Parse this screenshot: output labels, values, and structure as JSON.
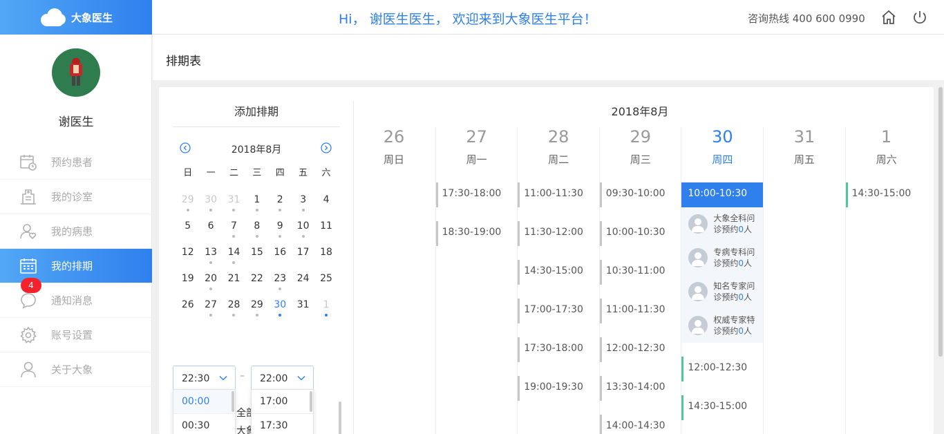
{
  "header": {
    "logo_text": "大象医生",
    "welcome": "Hi， 谢医生医生， 欢迎来到大象医生平台！",
    "hotline": "咨询热线 400 600 0990"
  },
  "sidebar": {
    "doctor_name": "谢医生",
    "items": [
      {
        "label": "预约患者",
        "icon": "calendar-clock-icon"
      },
      {
        "label": "我的诊室",
        "icon": "building-icon"
      },
      {
        "label": "我的病患",
        "icon": "patient-heart-icon"
      },
      {
        "label": "我的排期",
        "icon": "schedule-grid-icon"
      },
      {
        "label": "通知消息",
        "icon": "message-icon",
        "badge": "4"
      },
      {
        "label": "账号设置",
        "icon": "gear-icon"
      },
      {
        "label": "关于大象",
        "icon": "user-icon"
      }
    ]
  },
  "page": {
    "title": "排期表"
  },
  "add_panel": {
    "title": "添加排期",
    "calendar": {
      "month": "2018年8月",
      "weekdays": [
        "日",
        "一",
        "二",
        "三",
        "四",
        "五",
        "六"
      ],
      "weeks": [
        [
          {
            "d": "29",
            "dim": true,
            "dot": true
          },
          {
            "d": "30",
            "dim": true,
            "dot": true
          },
          {
            "d": "31",
            "dim": true,
            "dot": true
          },
          {
            "d": "1",
            "dot": true
          },
          {
            "d": "2",
            "dot": true
          },
          {
            "d": "3",
            "dot": true
          },
          {
            "d": "4"
          }
        ],
        [
          {
            "d": "5"
          },
          {
            "d": "6"
          },
          {
            "d": "7",
            "dot": true
          },
          {
            "d": "8",
            "dot": true
          },
          {
            "d": "9",
            "dot": true
          },
          {
            "d": "10",
            "dot": true
          },
          {
            "d": "11"
          }
        ],
        [
          {
            "d": "12"
          },
          {
            "d": "13",
            "dot": true
          },
          {
            "d": "14",
            "dot": true
          },
          {
            "d": "15"
          },
          {
            "d": "16"
          },
          {
            "d": "17"
          },
          {
            "d": "18"
          }
        ],
        [
          {
            "d": "19"
          },
          {
            "d": "20",
            "dot": true
          },
          {
            "d": "21"
          },
          {
            "d": "22"
          },
          {
            "d": "23",
            "dot": true
          },
          {
            "d": "24"
          },
          {
            "d": "25"
          }
        ],
        [
          {
            "d": "26"
          },
          {
            "d": "27",
            "dot": true
          },
          {
            "d": "28",
            "dot": true
          },
          {
            "d": "29",
            "dot": true
          },
          {
            "d": "30",
            "sel": true,
            "dot": true,
            "blue": true
          },
          {
            "d": "31"
          },
          {
            "d": "1",
            "dim": true,
            "dot": true,
            "blue": true
          }
        ]
      ]
    },
    "start_select": {
      "value": "22:30",
      "options": [
        "00:00",
        "00:30"
      ]
    },
    "end_select": {
      "value": "22:00",
      "options": [
        "17:00",
        "17:30"
      ]
    },
    "separator": "–",
    "partial_text_1": "全部",
    "partial_text_2": "大象"
  },
  "schedule": {
    "title": "2018年8月",
    "days": [
      {
        "num": "26",
        "name": "周日",
        "slots": []
      },
      {
        "num": "27",
        "name": "周一",
        "slots": [
          "17:30-18:00",
          "18:30-19:00"
        ]
      },
      {
        "num": "28",
        "name": "周二",
        "slots": [
          "11:00-11:30",
          "11:30-12:00",
          "14:30-15:00",
          "17:00-17:30",
          "17:30-18:00",
          "19:00-19:30"
        ]
      },
      {
        "num": "29",
        "name": "周三",
        "slots": [
          "09:30-10:00",
          "10:00-10:30",
          "10:30-11:00",
          "11:00-11:30",
          "12:00-12:30",
          "13:30-14:00",
          "14:00-14:30"
        ]
      },
      {
        "num": "30",
        "name": "周四",
        "today": true,
        "active_slot": "10:00-10:30",
        "services": [
          {
            "line1": "大象全科问",
            "line2": "诊预约",
            "count": "0",
            "unit": "人"
          },
          {
            "line1": "专病专科问",
            "line2": "诊预约",
            "count": "0",
            "unit": "人"
          },
          {
            "line1": "知名专家问",
            "line2": "诊预约",
            "count": "0",
            "unit": "人"
          },
          {
            "line1": "权威专家特",
            "line2": "诊预约",
            "count": "0",
            "unit": "人"
          }
        ],
        "slots": [
          "12:00-12:30",
          "14:30-15:00"
        ]
      },
      {
        "num": "31",
        "name": "周五",
        "slots": []
      },
      {
        "num": "1",
        "name": "周六",
        "slots": [
          "14:30-15:00"
        ]
      }
    ]
  },
  "colors": {
    "accent": "#2f80ed",
    "badge": "#f5222d",
    "slot_green": "#52c4a0"
  }
}
